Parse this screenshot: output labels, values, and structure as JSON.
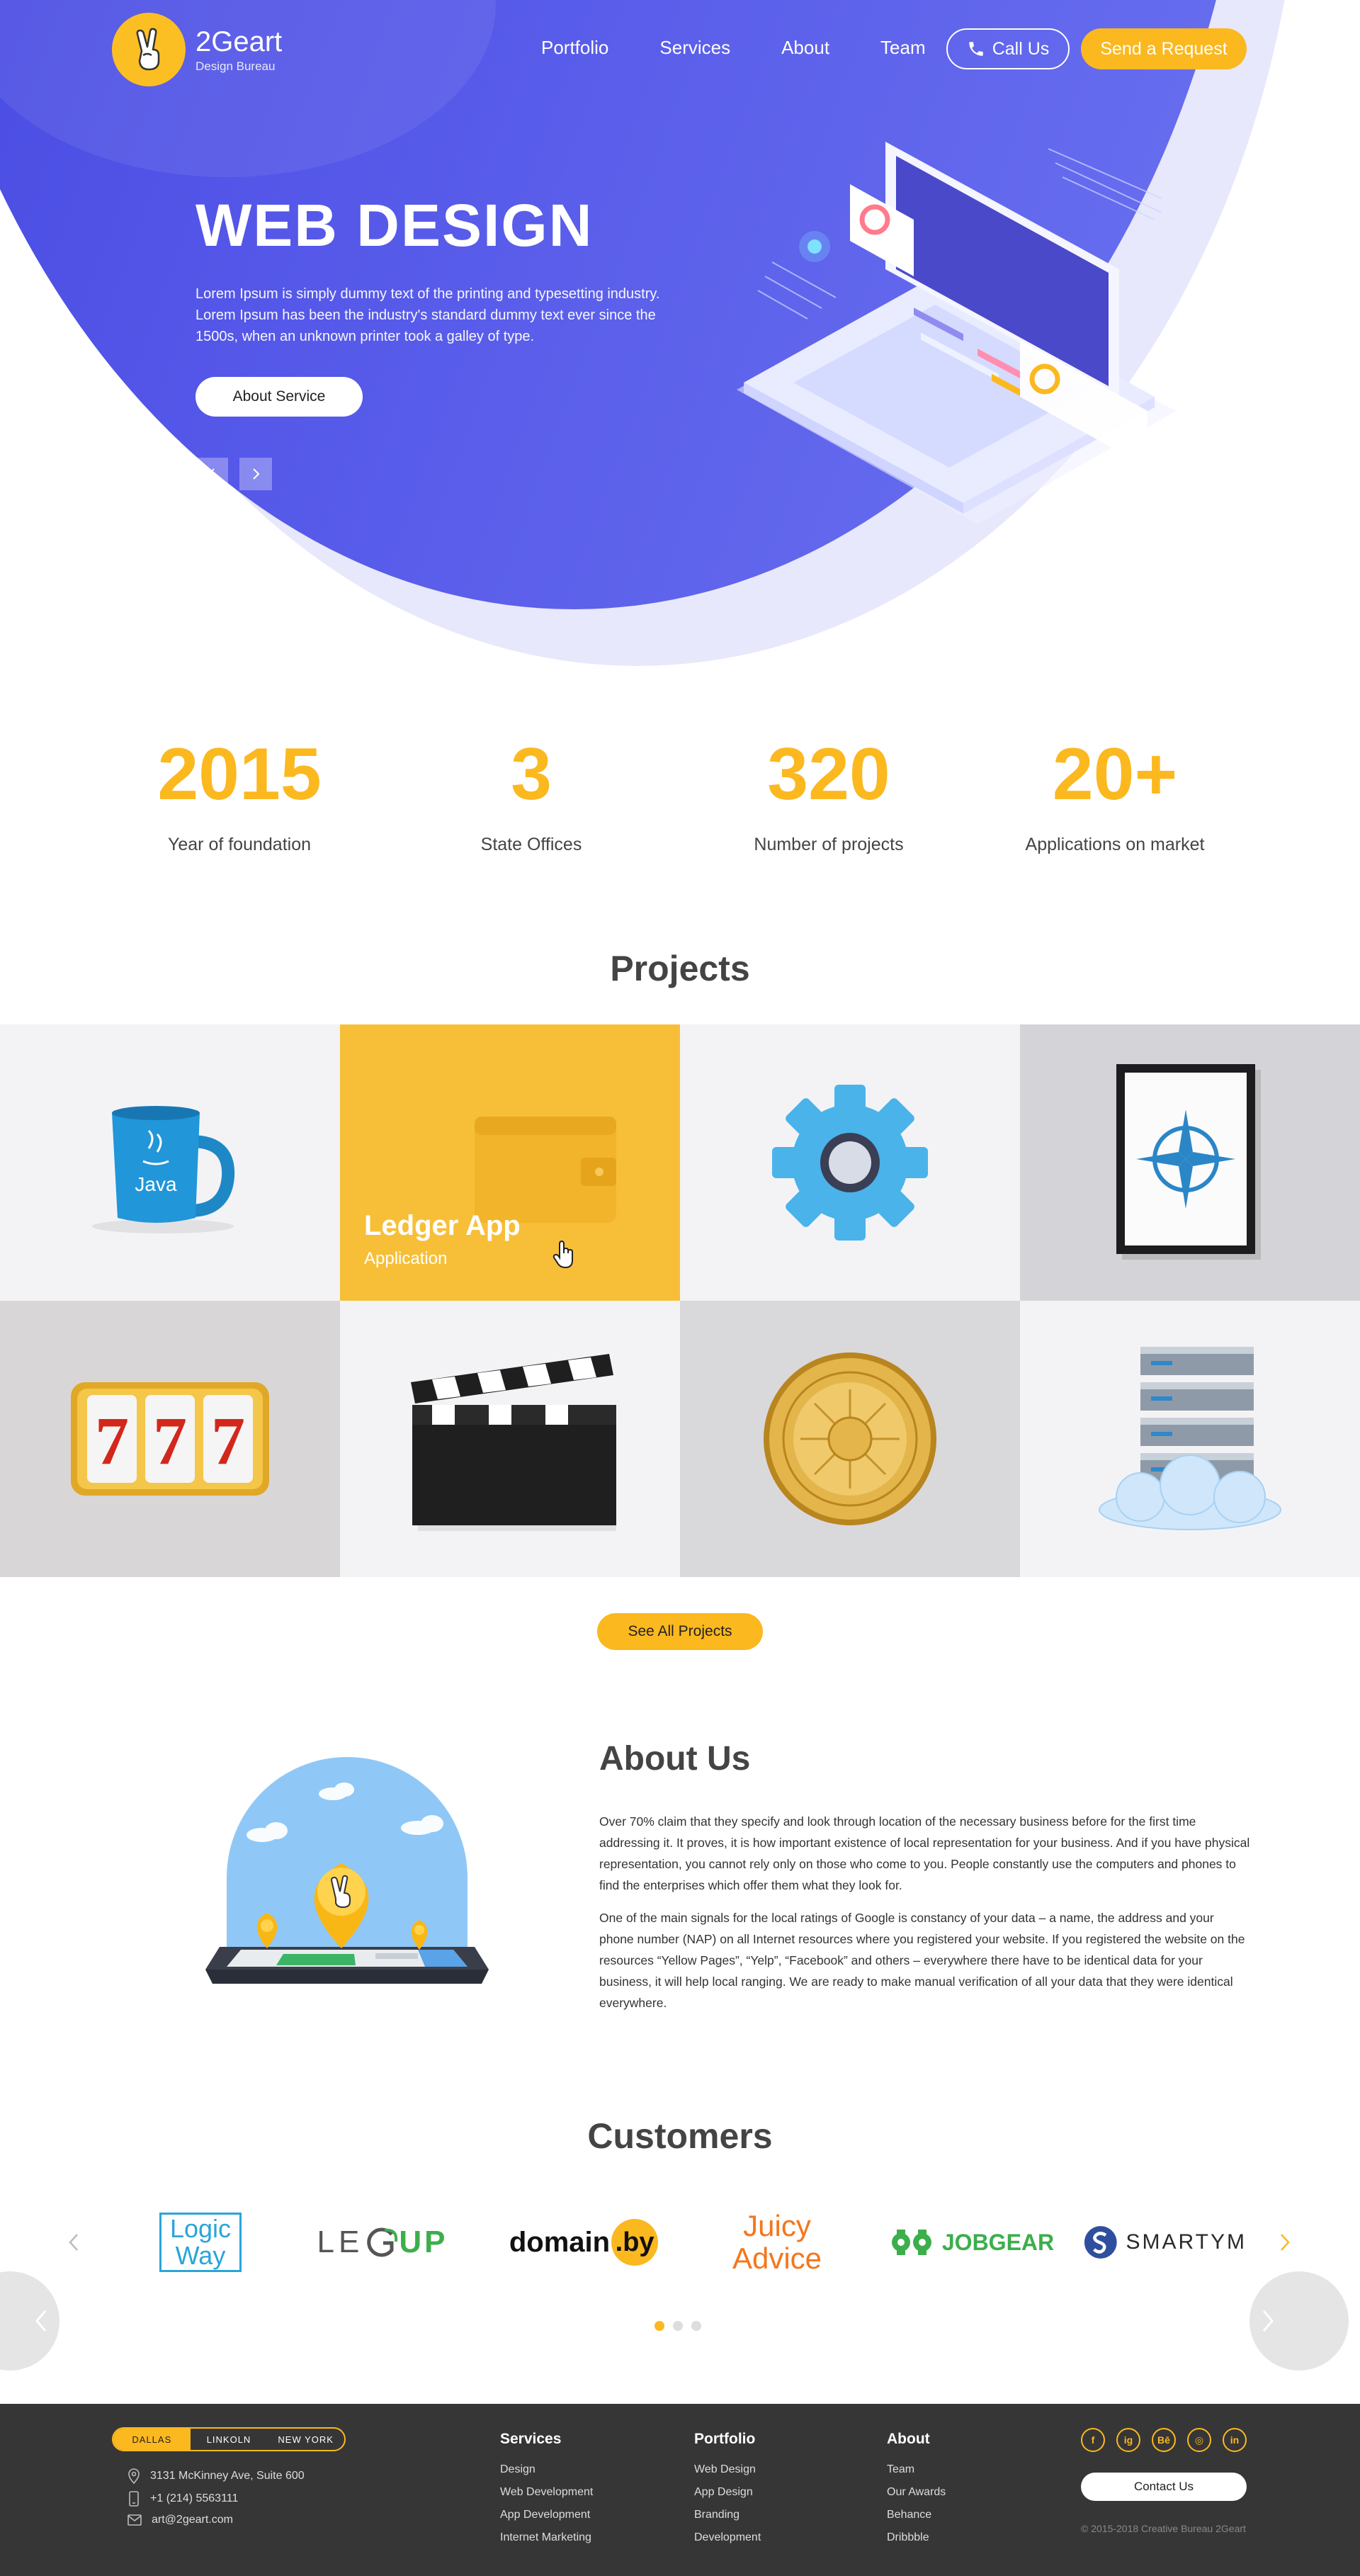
{
  "header": {
    "brand_name": "2Geart",
    "brand_sub": "Design Bureau",
    "nav": [
      "Portfolio",
      "Services",
      "About",
      "Team"
    ],
    "call_label": "Call Us",
    "request_label": "Send a Request"
  },
  "hero": {
    "title": "WEB DESIGN",
    "text": "Lorem Ipsum is simply dummy text of the printing and typesetting industry. Lorem Ipsum has been the industry's standard dummy text ever since the 1500s, when an unknown printer took a galley of type.",
    "button": "About Service",
    "prev_icon": "chevron-left-icon",
    "next_icon": "chevron-right-icon"
  },
  "stats": [
    {
      "value": "2015",
      "label": "Year of foundation"
    },
    {
      "value": "3",
      "label": "State Offices"
    },
    {
      "value": "320",
      "label": "Number of projects"
    },
    {
      "value": "20+",
      "label": "Applications on market"
    }
  ],
  "projects": {
    "title": "Projects",
    "highlight": {
      "title": "Ledger App",
      "subtitle": "Application"
    },
    "tiles": [
      "java-mug",
      "wallet",
      "gear",
      "compass-frame",
      "slot-777",
      "clapperboard",
      "gold-coin",
      "server-cloud"
    ],
    "button": "See All Projects"
  },
  "about": {
    "title": "About Us",
    "p1": "Over 70% claim that they specify and look through location of the necessary business before for the first time addressing it. It proves, it is how important existence of local representation for your business. And if you have physical representation, you cannot rely only on those who come to you. People constantly use the computers and phones to find the enterprises which offer them what they look for.",
    "p2": "One of the main signals for the local ratings of Google is constancy of your data – a name, the address and your phone number (NAP) on all Internet resources where you registered your website. If you registered the website on the resources “Yellow Pages”, “Yelp”, “Facebook” and others – everywhere there have to be identical data for your business, it will help local ranging. We are ready to make manual verification of all your data that they were identical everywhere."
  },
  "customers": {
    "title": "Customers",
    "logos": {
      "logicway_1": "Logic",
      "logicway_2": "Way",
      "legup_1": "LE",
      "legup_2": "UP",
      "domain_1": "domain",
      "domain_2": ".by",
      "juicy_1": "Juicy",
      "juicy_2": "Advice",
      "jobgear": "JOBGEAR",
      "smartym": "SMARTYM"
    },
    "page_count": 3,
    "active_page": 1
  },
  "footer": {
    "cities": [
      "DALLAS",
      "LINKOLN",
      "NEW YORK"
    ],
    "address": "3131 McKinney Ave, Suite 600",
    "phone": "+1 (214) 5563111",
    "email": "art@2geart.com",
    "columns": [
      {
        "title": "Services",
        "links": [
          "Design",
          "Web Development",
          "App Development",
          "Internet Marketing"
        ]
      },
      {
        "title": "Portfolio",
        "links": [
          "Web Design",
          "App Design",
          "Branding",
          "Development"
        ]
      },
      {
        "title": "About",
        "links": [
          "Team",
          "Our Awards",
          "Behance",
          "Dribbble"
        ]
      }
    ],
    "socials": [
      "f",
      "ig",
      "Bē",
      "◎",
      "in"
    ],
    "contact_button": "Contact Us",
    "copyright": "© 2015-2018 Creative Bureau 2Geart"
  },
  "colors": {
    "brand_yellow": "#fbb81f",
    "hero_blue": "#4a4ce2",
    "footer_bg": "#363636"
  }
}
